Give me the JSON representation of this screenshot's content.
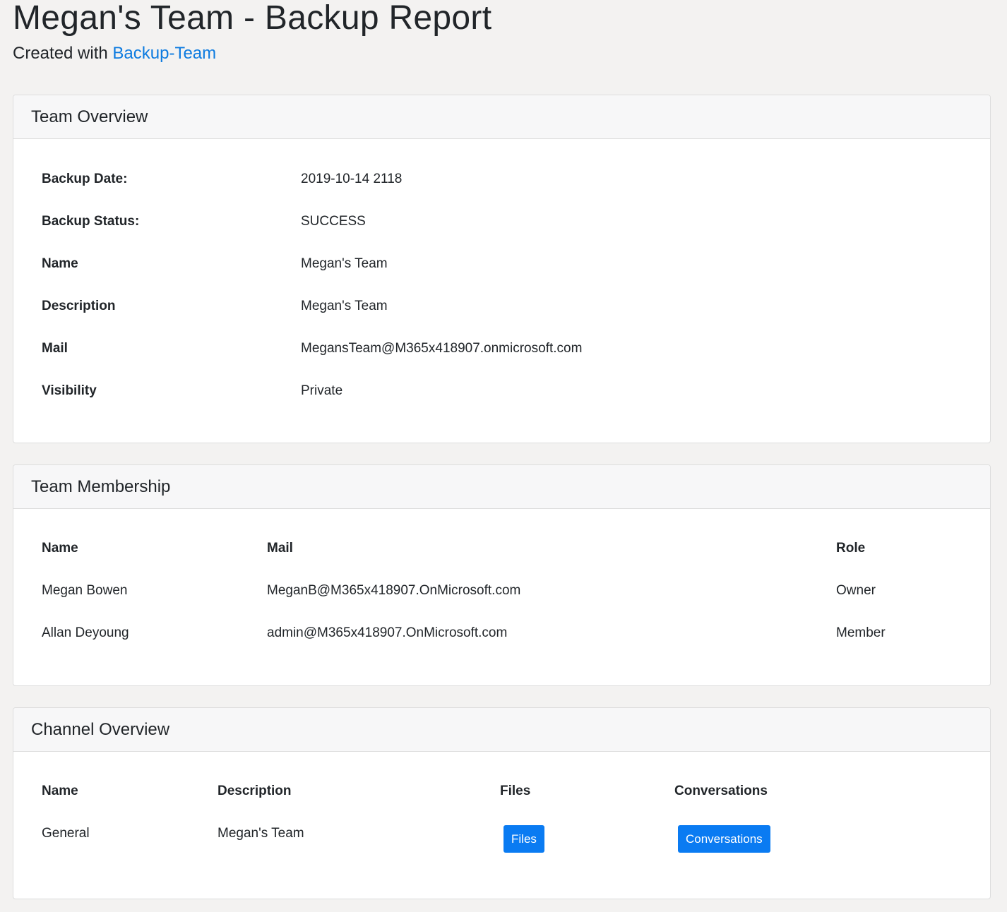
{
  "header": {
    "title": "Megan's Team - Backup Report",
    "subtitle_prefix": "Created with",
    "subtitle_link": "Backup-Team"
  },
  "team_overview": {
    "heading": "Team Overview",
    "rows": [
      {
        "label": "Backup Date:",
        "value": "2019-10-14 2118"
      },
      {
        "label": "Backup Status:",
        "value": "SUCCESS"
      },
      {
        "label": "Name",
        "value": "Megan's Team"
      },
      {
        "label": "Description",
        "value": "Megan's Team"
      },
      {
        "label": "Mail",
        "value": "MegansTeam@M365x418907.onmicrosoft.com"
      },
      {
        "label": "Visibility",
        "value": "Private"
      }
    ]
  },
  "team_membership": {
    "heading": "Team Membership",
    "columns": [
      "Name",
      "Mail",
      "Role"
    ],
    "rows": [
      [
        "Megan Bowen",
        "MeganB@M365x418907.OnMicrosoft.com",
        "Owner"
      ],
      [
        "Allan Deyoung",
        "admin@M365x418907.OnMicrosoft.com",
        "Member"
      ]
    ]
  },
  "channel_overview": {
    "heading": "Channel Overview",
    "columns": [
      "Name",
      "Description",
      "Files",
      "Conversations"
    ],
    "rows": [
      {
        "name": "General",
        "description": "Megan's Team",
        "files_button": "Files",
        "conversations_button": "Conversations"
      }
    ]
  },
  "colors": {
    "accent": "#0a7bf2",
    "link": "#0d7be0",
    "background": "#f3f2f1"
  }
}
